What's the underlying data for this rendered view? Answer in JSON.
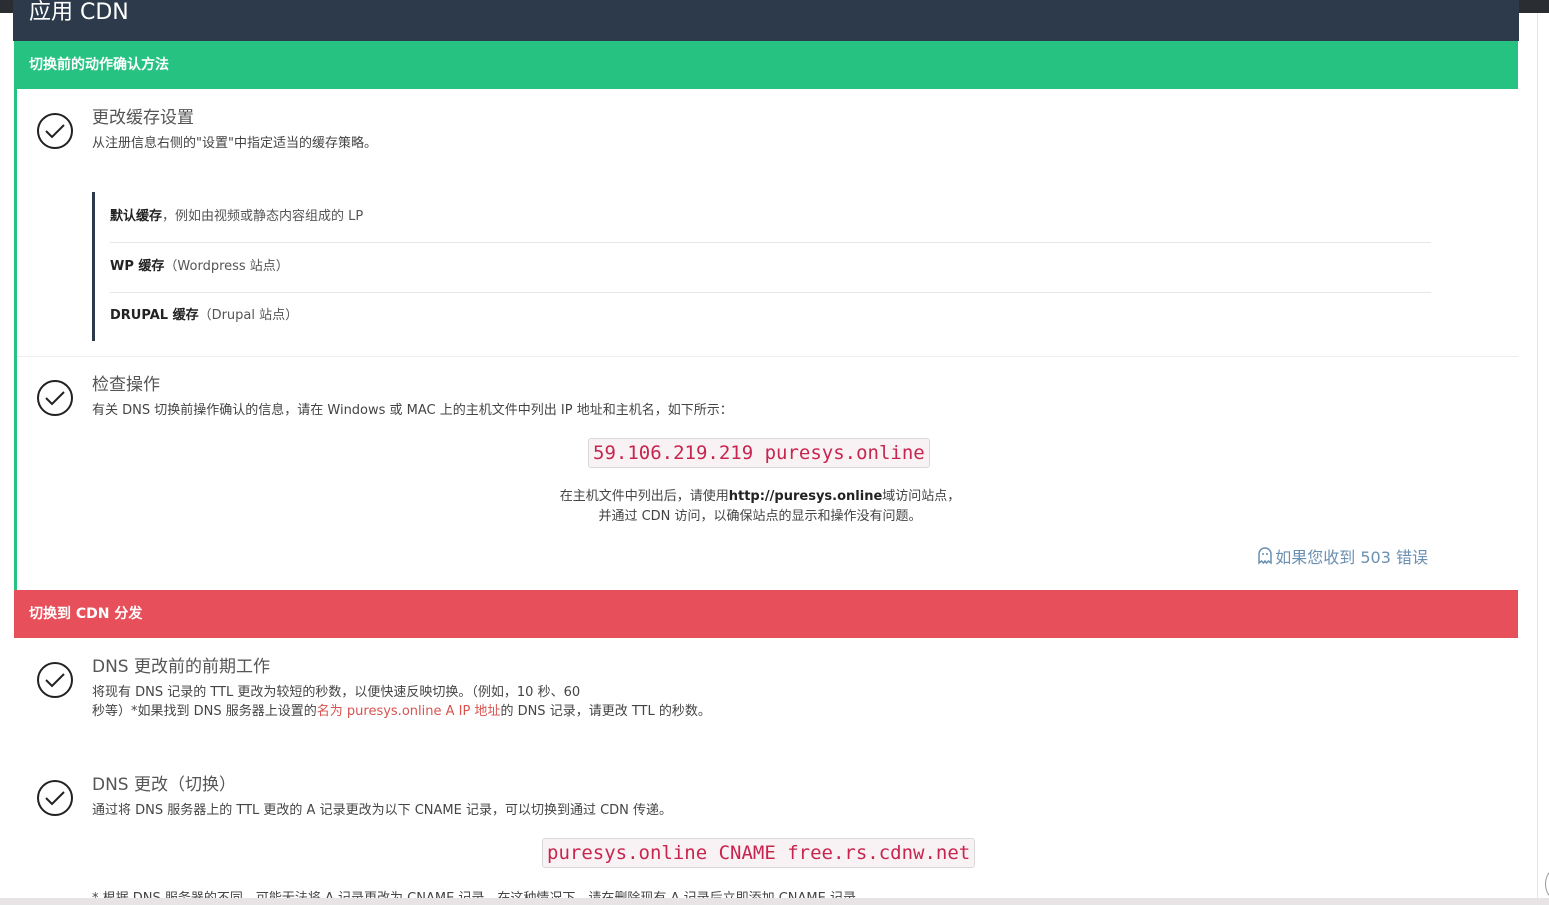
{
  "page": {
    "title": "应用 CDN"
  },
  "section1": {
    "header": "切换前的动作确认方法",
    "item1": {
      "title": "更改缓存设置",
      "desc": "从注册信息右侧的\"设置\"中指定适当的缓存策略。",
      "cache_options": [
        {
          "bold": "默认缓存",
          "rest": "，例如由视频或静态内容组成的 LP"
        },
        {
          "bold": "WP 缓存",
          "rest": "（Wordpress 站点）"
        },
        {
          "bold": "DRUPAL 缓存",
          "rest": "（Drupal 站点）"
        }
      ]
    },
    "item2": {
      "title": "检查操作",
      "desc": "有关 DNS 切换前操作确认的信息，请在 Windows 或 MAC 上的主机文件中列出 IP 地址和主机名，如下所示：",
      "hosts_code": "59.106.219.219 puresys.online",
      "note_pre": "在主机文件中列出后，请使用",
      "note_url": "http://puresys.online",
      "note_post": "域访问站点，",
      "note_line2": "并通过 CDN 访问，以确保站点的显示和操作没有问题。",
      "error_link": "如果您收到 503 错误"
    }
  },
  "section2": {
    "header": "切换到 CDN 分发",
    "item1": {
      "title": "DNS 更改前的前期工作",
      "desc_line1": "将现有 DNS 记录的 TTL 更改为较短的秒数，以便快速反映切换。（例如，10 秒、60",
      "desc_line2_pre": "秒等）*如果找到 DNS 服务器上设置的",
      "desc_line2_red": "名为 puresys.online A IP 地址",
      "desc_line2_post": "的 DNS 记录，请更改 TTL 的秒数。"
    },
    "item2": {
      "title": "DNS 更改（切换）",
      "desc": "通过将 DNS 服务器上的 TTL 更改的 A 记录更改为以下 CNAME 记录，可以切换到通过 CDN 传递。",
      "cname_code": "puresys.online CNAME free.rs.cdnw.net",
      "cut_note": "* 根据 DNS 服务器的不同，可能无法将 A 记录更改为 CNAME 记录。在这种情况下，请在删除现有 A 记录后立即添加 CNAME 记录。"
    }
  },
  "colors": {
    "green": "#26c281",
    "red": "#e7505a",
    "navy": "#2c3a4b",
    "code_red": "#c7254e"
  },
  "icons": [
    "check-circle-icon",
    "ghost-icon"
  ]
}
